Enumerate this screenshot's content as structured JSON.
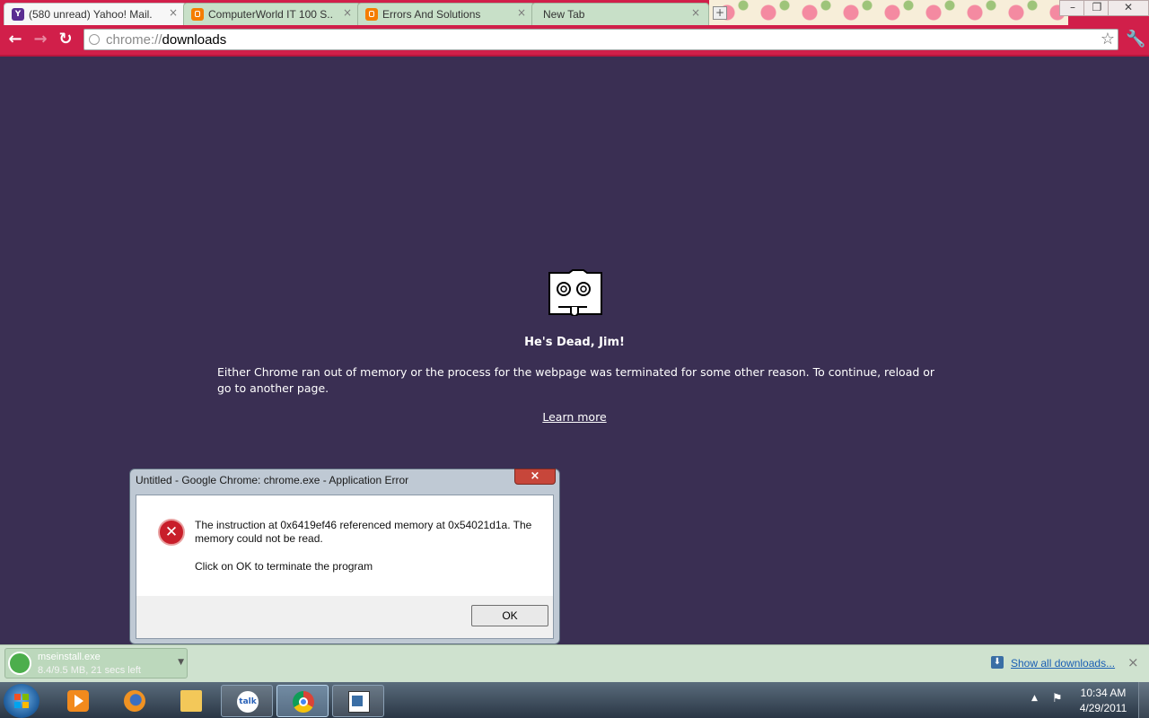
{
  "browser": {
    "tabs": [
      {
        "title": "(580 unread) Yahoo! Mail...",
        "icon": "yahoo-icon",
        "active": true
      },
      {
        "title": "ComputerWorld IT 100 S...",
        "icon": "blogger-icon",
        "active": false
      },
      {
        "title": "Errors And Solutions",
        "icon": "blogger-icon",
        "active": false
      },
      {
        "title": "New Tab",
        "icon": "none",
        "active": false
      }
    ],
    "tab_close_glyph": "×",
    "address_scheme": "chrome://",
    "address_path": "downloads",
    "colors": {
      "theme": "#d11f4a",
      "page_background": "#3a2f53"
    }
  },
  "sad_tab": {
    "title": "He's Dead, Jim!",
    "message": "Either Chrome ran out of memory or the process for the webpage was terminated for some other reason.  To continue, reload or go to another page.",
    "link": "Learn more"
  },
  "dialog": {
    "title": "Untitled - Google Chrome: chrome.exe - Application Error",
    "close_glyph": "×",
    "icon": "error-icon",
    "message": "The instruction at 0x6419ef46 referenced memory at 0x54021d1a. The memory could not be read.",
    "instruction": "Click on OK to terminate the program",
    "ok_label": "OK"
  },
  "downloads": {
    "item_name": "mseinstall.exe",
    "item_status": "8.4/9.5 MB, 21 secs left",
    "show_all": "Show all downloads...",
    "close_glyph": "×"
  },
  "taskbar": {
    "pinned": [
      "windows-media-player-icon",
      "firefox-icon",
      "windows-explorer-icon",
      "google-talk-icon",
      "chrome-icon",
      "window-icon"
    ],
    "talk_label": "talk",
    "time": "10:34 AM",
    "date": "4/29/2011"
  }
}
